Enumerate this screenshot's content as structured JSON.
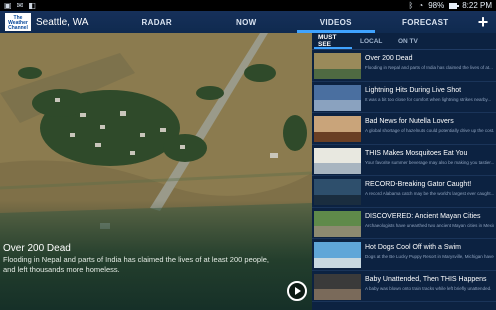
{
  "status_bar": {
    "left_icons": [
      "image-icon",
      "mail-icon",
      "bag-icon"
    ],
    "battery": "98%",
    "time": "8:22 PM"
  },
  "header": {
    "logo_text": "The Weather Channel",
    "location": "Seattle, WA",
    "tabs": [
      {
        "label": "RADAR",
        "active": false
      },
      {
        "label": "NOW",
        "active": false
      },
      {
        "label": "VIDEOS",
        "active": true
      },
      {
        "label": "FORECAST",
        "active": false
      }
    ],
    "add_label": "+"
  },
  "hero": {
    "title": "Over 200 Dead",
    "description": "Flooding in Nepal and parts of India has claimed the lives of at least 200 people, and left thousands more homeless."
  },
  "sidebar": {
    "subtabs": [
      {
        "label": "MUST SEE",
        "active": true
      },
      {
        "label": "LOCAL",
        "active": false
      },
      {
        "label": "ON TV",
        "active": false
      }
    ],
    "items": [
      {
        "title": "Over 200 Dead",
        "subtitle": "Flooding in Nepal and parts of India has claimed the lives of at...",
        "thumb_top": "#9a8a5a",
        "thumb_bottom": "#4f6a42"
      },
      {
        "title": "Lightning Hits During Live Shot",
        "subtitle": "It was a bit too close for comfort when lightning strikes nearby...",
        "thumb_top": "#4a6fa0",
        "thumb_bottom": "#8aa2bf"
      },
      {
        "title": "Bad News for Nutella Lovers",
        "subtitle": "A global shortage of hazelnuts could potentially drive up the cost...",
        "thumb_top": "#c9a47a",
        "thumb_bottom": "#6a3f24"
      },
      {
        "title": "THIS Makes Mosquitoes Eat You",
        "subtitle": "Your favorite summer beverage may also be making you tastier...",
        "thumb_top": "#e8e8e0",
        "thumb_bottom": "#a8b5c0"
      },
      {
        "title": "RECORD-Breaking Gator Caught!",
        "subtitle": "A record Alabama catch may be the world's largest ever caught...",
        "thumb_top": "#2e4f6c",
        "thumb_bottom": "#1a2d3f"
      },
      {
        "title": "DISCOVERED: Ancient Mayan Cities",
        "subtitle": "Archaeologists have unearthed two ancient Mayan cities in Mexico...",
        "thumb_top": "#5f8a4a",
        "thumb_bottom": "#8c8a70"
      },
      {
        "title": "Hot Dogs Cool Off with a Swim",
        "subtitle": "Dogs at the Be Lucky Puppy Resort in Marysville, Michigan have a...",
        "thumb_top": "#5fa6d8",
        "thumb_bottom": "#c8d8e0"
      },
      {
        "title": "Baby Unattended, Then THIS Happens",
        "subtitle": "A baby was blown onto train tracks while left briefly unattended.",
        "thumb_top": "#3a3a3a",
        "thumb_bottom": "#7a6a5a"
      }
    ]
  }
}
